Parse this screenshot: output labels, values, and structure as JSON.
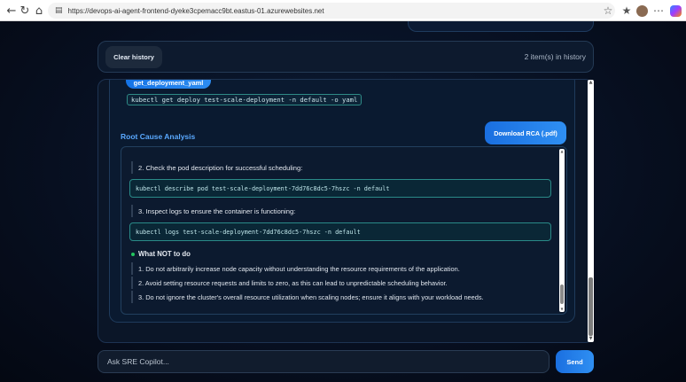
{
  "browser": {
    "url": "https://devops-ai-agent-frontend-dyeke3cpemacc9bt.eastus-01.azurewebsites.net"
  },
  "history": {
    "clear_label": "Clear history",
    "count_text": "2 item(s) in history"
  },
  "message": {
    "tool_label": "get_deployment_yaml",
    "command": "kubectl get deploy test-scale-deployment -n default -o yaml",
    "rca_title": "Root Cause Analysis",
    "download_label": "Download RCA (.pdf)"
  },
  "rca": {
    "steps": [
      {
        "text": "2. Check the pod description for successful scheduling:",
        "code": "kubectl describe pod test-scale-deployment-7dd76c8dc5-7hszc -n default"
      },
      {
        "text": "3. Inspect logs to ensure the container is functioning:",
        "code": "kubectl logs test-scale-deployment-7dd76c8dc5-7hszc -n default"
      }
    ],
    "not_heading": "What NOT to do",
    "not_items": [
      "1. Do not arbitrarily increase node capacity without understanding the resource requirements of the application.",
      "2. Avoid setting resource requests and limits to zero, as this can lead to unpredictable scheduling behavior.",
      "3. Do not ignore the cluster's overall resource utilization when scaling nodes; ensure it aligns with your workload needs."
    ]
  },
  "input": {
    "placeholder": "Ask SRE Copilot...",
    "send_label": "Send"
  },
  "colors": {
    "accent": "#2d8cf0",
    "rca_title": "#5aa9ff",
    "status_dot": "#22c55e",
    "code_border": "#2a8a88"
  },
  "icons": {
    "back": "arrow-left-icon",
    "reload": "reload-icon",
    "home": "home-icon",
    "site_info": "site-info-icon",
    "favorite": "star-icon",
    "collections": "collections-icon",
    "profile": "avatar-icon",
    "more": "more-icon",
    "copilot": "copilot-icon"
  }
}
